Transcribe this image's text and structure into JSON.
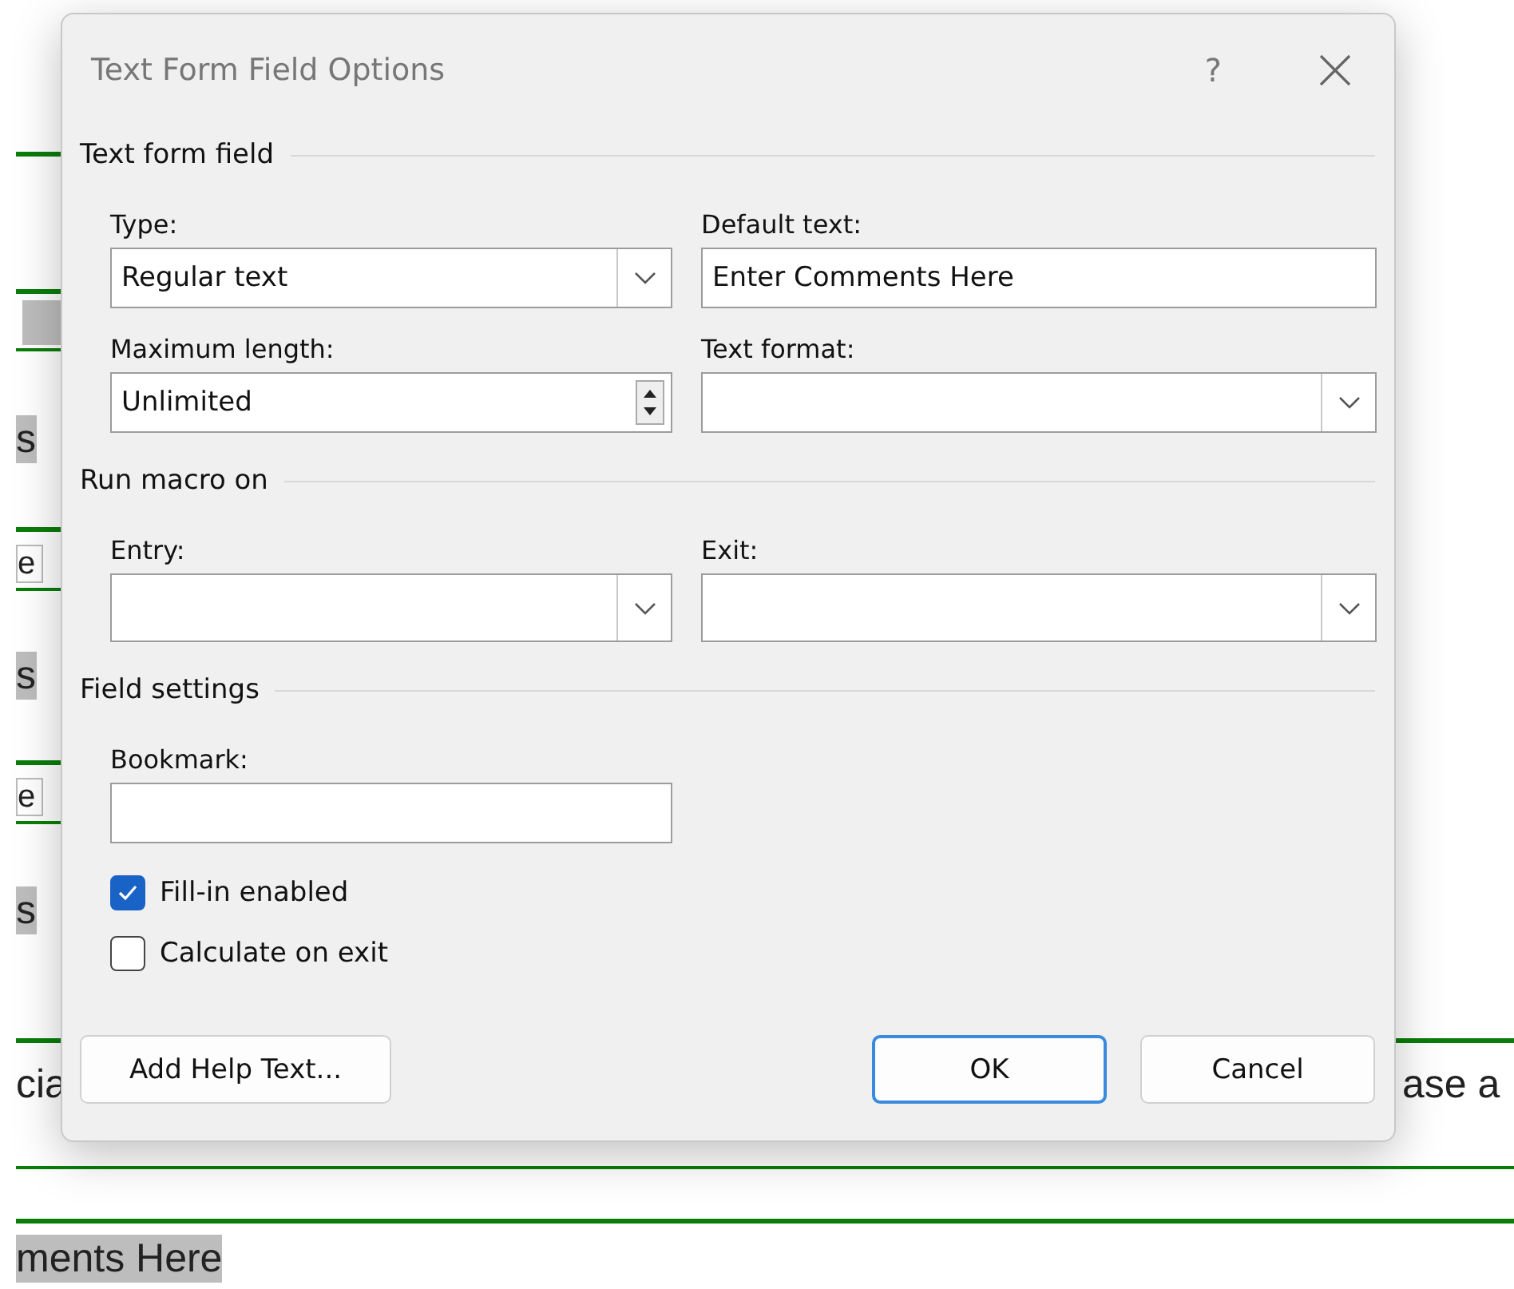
{
  "window": {
    "title": "Text Form Field Options",
    "help": "?"
  },
  "text_form_field": {
    "title": "Text form field",
    "type": {
      "label": "Type:",
      "value": "Regular text"
    },
    "default_text": {
      "label": "Default text:",
      "value": "Enter Comments Here"
    },
    "maximum_length": {
      "label": "Maximum length:",
      "value": "Unlimited"
    },
    "text_format": {
      "label": "Text format:"
    }
  },
  "run_macro_on": {
    "title": "Run macro on",
    "entry": {
      "label": "Entry:"
    },
    "exit": {
      "label": "Exit:"
    }
  },
  "field_settings": {
    "title": "Field settings",
    "bookmark": {
      "label": "Bookmark:"
    },
    "options": [
      {
        "label": "Fill-in enabled",
        "checked": true
      },
      {
        "label": "Calculate on exit",
        "checked": false
      }
    ]
  },
  "buttons": [
    {
      "label": "Add Help Text...",
      "default": false
    },
    {
      "label": "OK",
      "default": true
    },
    {
      "label": "Cancel",
      "default": false
    }
  ],
  "background_document": {
    "fragments": [
      "s",
      "e",
      "s",
      "e",
      "s",
      "cia",
      "ase a",
      "ments Here"
    ]
  }
}
